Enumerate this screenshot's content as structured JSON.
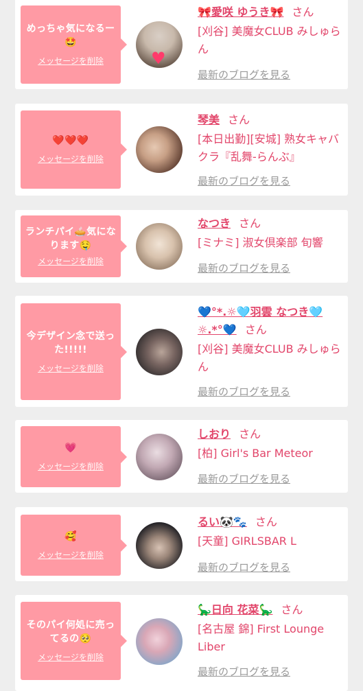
{
  "entries": [
    {
      "message": "めっちゃ気になるー🤩",
      "delete_label": "メッセージを削除",
      "name": "🎀愛咲 ゆうき🎀",
      "honorific": "さん",
      "shop": "[刈谷] 美魔女CLUB みしゅらん",
      "blog_label": "最新のブログを見る",
      "avatar_colors": [
        "#d9cfc6",
        "#6b5a4e"
      ],
      "avatar_heart": "♥"
    },
    {
      "message": "❤️❤️❤️",
      "delete_label": "メッセージを削除",
      "name": "琴美",
      "honorific": "さん",
      "shop": "[本日出勤][安城] 熟女キャバクラ『乱舞-らんぶ』",
      "blog_label": "最新のブログを見る",
      "avatar_colors": [
        "#5a3a2e",
        "#e6c9b3"
      ]
    },
    {
      "message": "ランチパイ🥧気になります🤤",
      "delete_label": "メッセージを削除",
      "name": "なつき",
      "honorific": "さん",
      "shop": "[ミナミ] 淑女倶楽部 旬響",
      "blog_label": "最新のブログを見る",
      "avatar_colors": [
        "#eae1d8",
        "#b89a7c"
      ]
    },
    {
      "message": "今デザイン念で送った!!!!!",
      "delete_label": "メッセージを削除",
      "name": "💙°*.☼🩵羽雲 なつき🩵☼.*°💙",
      "honorific": "さん",
      "shop": "[刈谷] 美魔女CLUB みしゅらん",
      "blog_label": "最新のブログを見る",
      "avatar_colors": [
        "#2d2a2b",
        "#b9a59a"
      ]
    },
    {
      "message": "💗",
      "delete_label": "メッセージを削除",
      "name": "しおり",
      "honorific": "さん",
      "shop": "[柏] Girl's Bar Meteor",
      "blog_label": "最新のブログを見る",
      "avatar_colors": [
        "#d9c8cf",
        "#6d5b66"
      ]
    },
    {
      "message": "🥰",
      "delete_label": "メッセージを削除",
      "name": "るい🐼🐾",
      "honorific": "さん",
      "shop": "[天童] GIRLSBAR L",
      "blog_label": "最新のブログを見る",
      "avatar_colors": [
        "#1d1d22",
        "#d7c2b4"
      ]
    },
    {
      "message": "そのパイ何処に売ってるの🥺",
      "delete_label": "メッセージを削除",
      "name": "🦕日向 花菜🦕",
      "honorific": "さん",
      "shop": "[名古屋 錦] First Lounge Liber",
      "blog_label": "最新のブログを見る",
      "avatar_colors": [
        "#e8b8c4",
        "#7fa6c9"
      ]
    }
  ]
}
